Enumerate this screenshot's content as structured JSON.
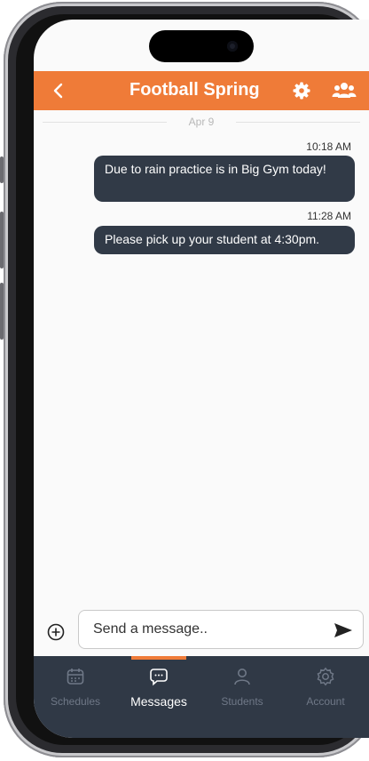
{
  "header": {
    "title": "Football Spring"
  },
  "chat": {
    "date_divider": "Apr 9",
    "messages": [
      {
        "time": "10:18 AM",
        "text": "Due to rain practice is in Big Gym today!"
      },
      {
        "time": "11:28 AM",
        "text": "Please pick up your student at 4:30pm."
      }
    ]
  },
  "composer": {
    "placeholder": "Send a message.."
  },
  "tabs": [
    {
      "label": "Schedules",
      "icon": "calendar-icon",
      "active": false
    },
    {
      "label": "Messages",
      "icon": "chat-bubble-icon",
      "active": true
    },
    {
      "label": "Students",
      "icon": "person-icon",
      "active": false
    },
    {
      "label": "Account",
      "icon": "gear-icon",
      "active": false
    }
  ],
  "colors": {
    "accent": "#ef7b38",
    "bubble": "#313a47",
    "tabbar": "#303946"
  }
}
